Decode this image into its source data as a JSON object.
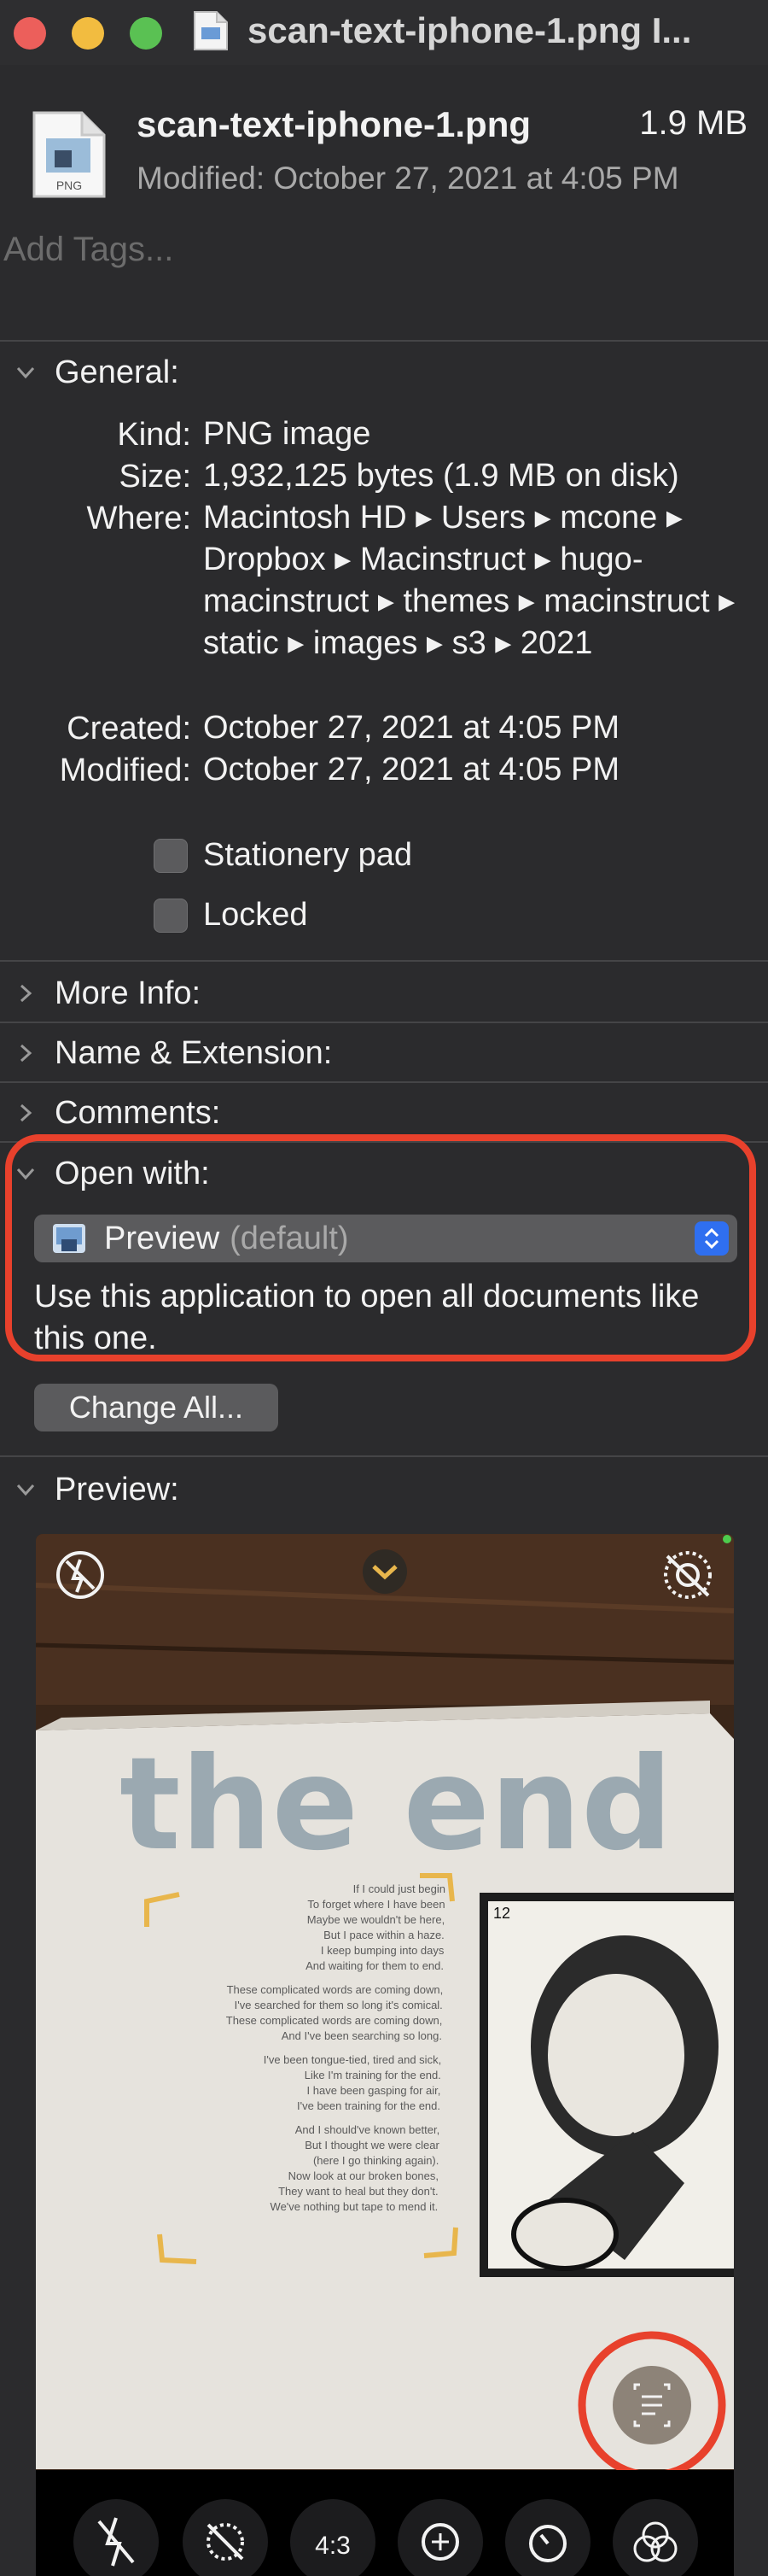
{
  "window": {
    "title": "scan-text-iphone-1.png I..."
  },
  "file": {
    "name": "scan-text-iphone-1.png",
    "size": "1.9 MB",
    "modified": "Modified: October 27, 2021 at 4:05 PM",
    "icon_label": "PNG"
  },
  "tags": {
    "placeholder": "Add Tags..."
  },
  "general": {
    "header": "General:",
    "rows": [
      {
        "label": "Kind:",
        "value": "PNG image"
      },
      {
        "label": "Size:",
        "value": "1,932,125 bytes (1.9 MB on disk)"
      },
      {
        "label": "Where:",
        "value": "Macintosh HD ▸ Users ▸ mcone ▸ Dropbox ▸ Macinstruct ▸ hugo-macinstruct ▸ themes ▸ macinstruct ▸ static ▸ images ▸ s3 ▸ 2021"
      },
      {
        "label": "Created:",
        "value": "October 27, 2021 at 4:05 PM"
      },
      {
        "label": "Modified:",
        "value": "October 27, 2021 at 4:05 PM"
      }
    ],
    "stationery_pad": "Stationery pad",
    "locked": "Locked"
  },
  "sections": {
    "more_info": "More Info:",
    "name_extension": "Name & Extension:",
    "comments": "Comments:",
    "open_with": "Open with:",
    "preview": "Preview:"
  },
  "open_with": {
    "app_name": "Preview",
    "app_default": "(default)",
    "description": "Use this application to open all documents like this one.",
    "change_all": "Change All..."
  },
  "preview": {
    "zoom_label": "4:3",
    "page_number": "12",
    "headline": "the end",
    "poem_lines": [
      "If I could just begin",
      "To forget where I have been",
      "Maybe we wouldn't be here,",
      "But I pace within a haze.",
      "I keep bumping into days",
      "And waiting for them to end.",
      "",
      "These complicated words are coming down,",
      "I've searched for them so long it's comical.",
      "These complicated words are coming down,",
      "And I've been searching so long.",
      "",
      "I've been tongue-tied, tired and sick,",
      "Like I'm training for the end.",
      "I have been gasping for air,",
      "I've been training for the end.",
      "",
      "And I should've known better,",
      "But I thought we were clear",
      "(here I go thinking again).",
      "Now look at our broken bones,",
      "They want to heal but they don't.",
      "We've nothing but tape to mend it."
    ]
  },
  "colors": {
    "background": "#2b2b2d",
    "highlight": "#e8412c",
    "accent": "#2f6ff0"
  }
}
